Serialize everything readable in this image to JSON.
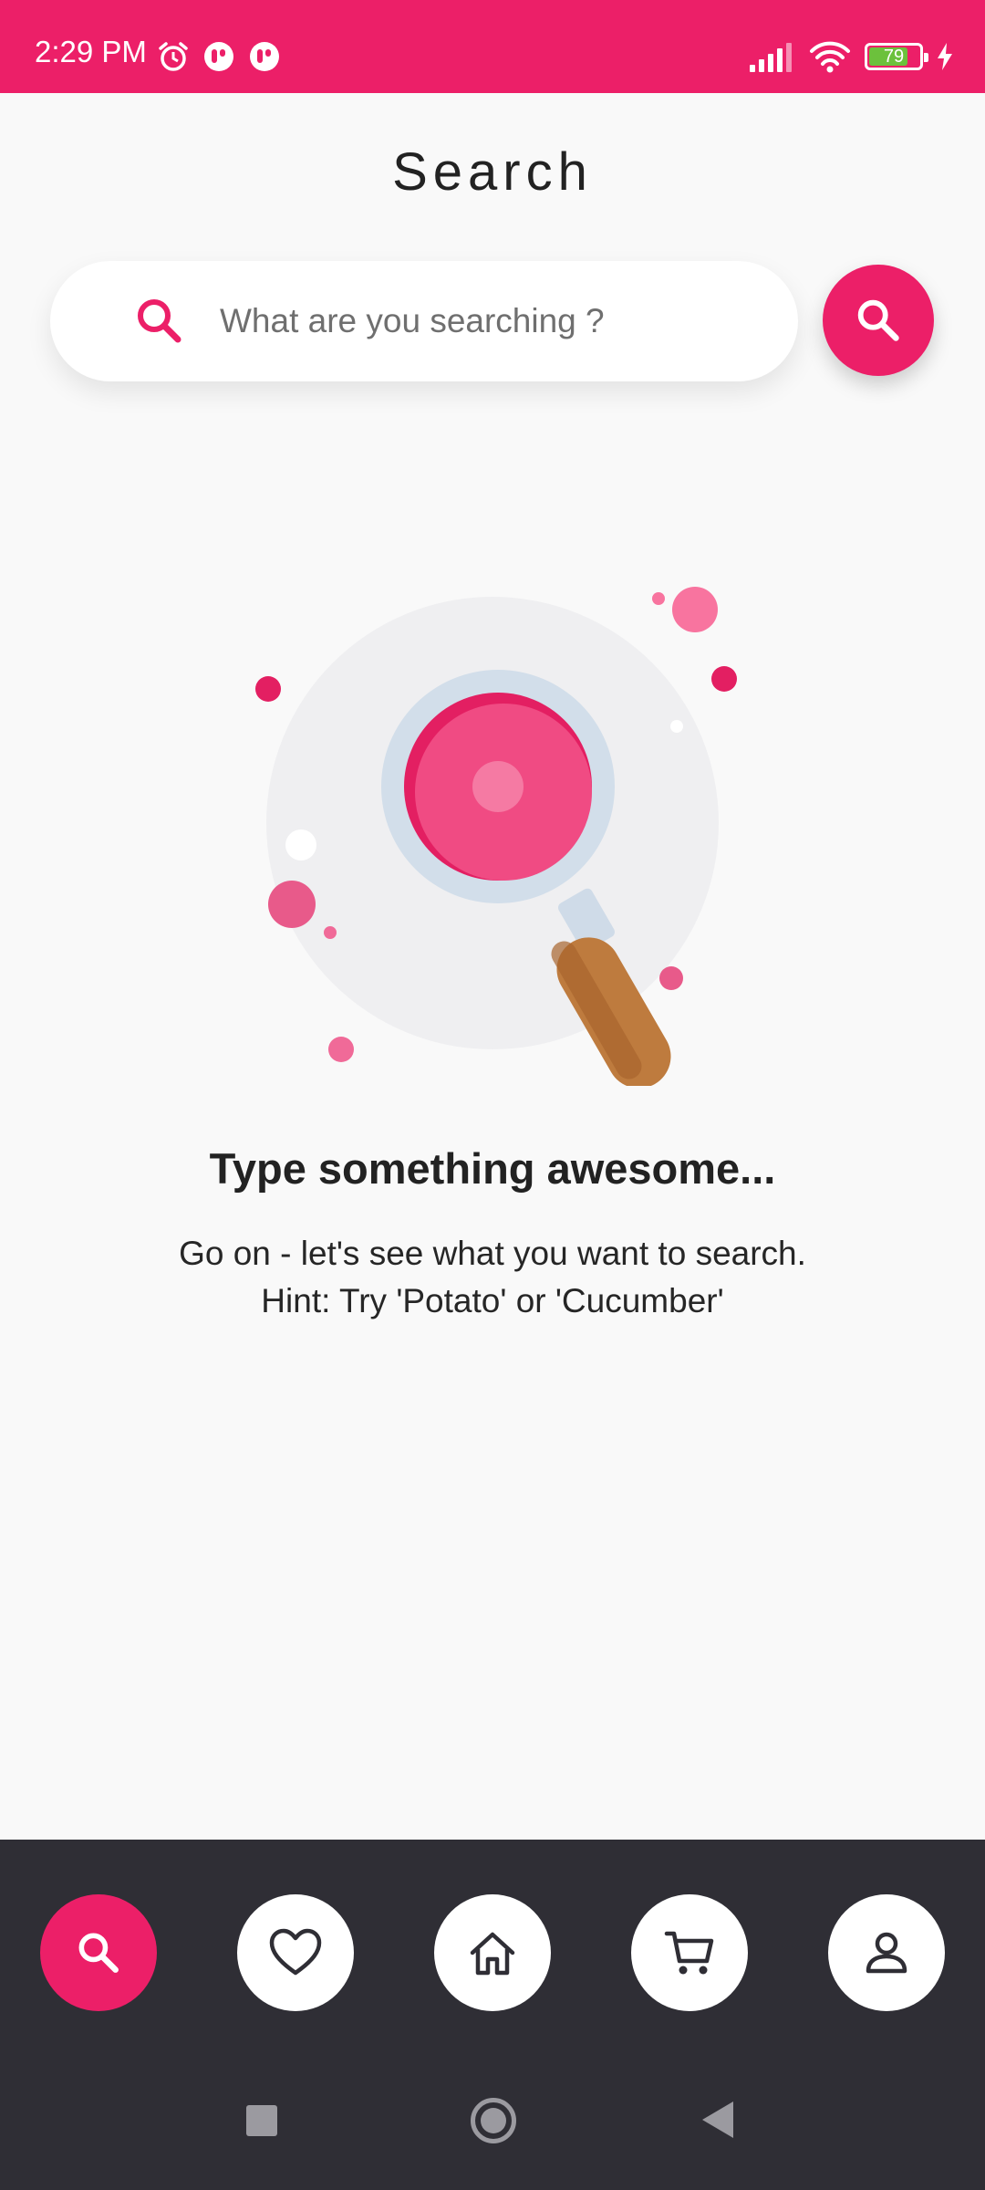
{
  "status_bar": {
    "time": "2:29 PM",
    "battery_level": "79",
    "left_icons": [
      "alarm-icon",
      "app-notification-icon",
      "app-notification-icon"
    ],
    "right_icons": [
      "signal-icon",
      "wifi-icon",
      "battery-icon",
      "charging-icon"
    ],
    "background_color": "#ec1f68"
  },
  "header": {
    "title": "Search"
  },
  "search": {
    "placeholder": "What are you searching ?",
    "value": "",
    "icon": "search-icon",
    "submit_icon": "search-icon"
  },
  "empty_state": {
    "illustration": "magnifying-glass-illustration",
    "title": "Type something awesome...",
    "subtitle_line1": "Go on - let's see what you want to search.",
    "subtitle_line2": "Hint: Try 'Potato' or 'Cucumber'"
  },
  "bottom_nav": {
    "items": [
      {
        "icon": "search-icon",
        "active": true
      },
      {
        "icon": "heart-icon",
        "active": false
      },
      {
        "icon": "home-icon",
        "active": false
      },
      {
        "icon": "cart-icon",
        "active": false
      },
      {
        "icon": "profile-icon",
        "active": false
      }
    ],
    "accent_color": "#ec1f68",
    "background_color": "#2f2e35"
  },
  "system_nav": {
    "buttons": [
      "recents-button",
      "home-button",
      "back-button"
    ]
  }
}
